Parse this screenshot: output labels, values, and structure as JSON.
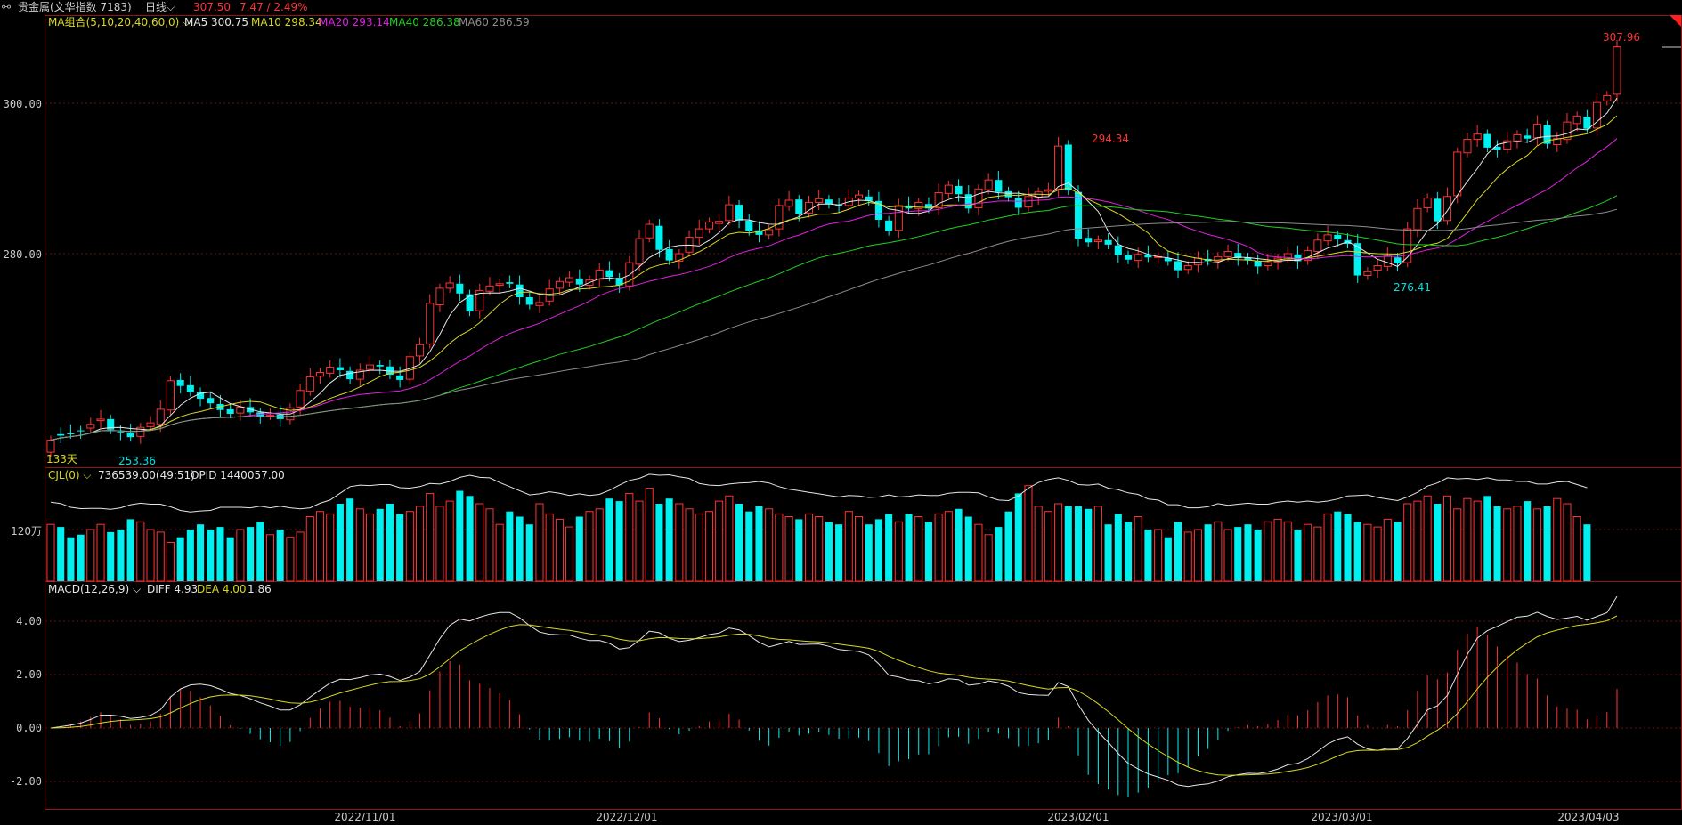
{
  "header": {
    "icon": "link-icon",
    "instrument": "贵金属(文华指数 7183)",
    "period": "日线",
    "last_price": "307.50",
    "change": "7.47 / 2.49%"
  },
  "colors": {
    "up": "#ff3333",
    "down": "#00f0f0",
    "ma5": "#e6e6e6",
    "ma10": "#d8d820",
    "ma20": "#e020e0",
    "ma40": "#20d020",
    "ma60": "#8c8c8c",
    "grid": "#6a1010",
    "diff": "#e6e6e6",
    "dea": "#d8d820"
  },
  "price_panel": {
    "indicator": "MA组合(5,10,20,40,60,0)",
    "ma_labels": [
      {
        "name": "MA5",
        "value": "300.75",
        "color": "#e6e6e6"
      },
      {
        "name": "MA10",
        "value": "298.34",
        "color": "#d8d820"
      },
      {
        "name": "MA20",
        "value": "293.14",
        "color": "#e020e0"
      },
      {
        "name": "MA40",
        "value": "286.38",
        "color": "#20d020"
      },
      {
        "name": "MA60",
        "value": "286.59",
        "color": "#8c8c8c"
      }
    ],
    "y_ticks": [
      "300.00",
      "280.00"
    ],
    "annotations": {
      "high_last": "307.96",
      "peak": "294.34",
      "low_start": "253.36",
      "low_mid": "276.41"
    },
    "days_label": "133天"
  },
  "volume_panel": {
    "indicator": "CJL(0)",
    "values_text": "736539.00(49:51)",
    "opid_text": "OPID 1440057.00",
    "y_tick": "120万"
  },
  "macd_panel": {
    "indicator": "MACD(12,26,9)",
    "diff_text": "DIFF 4.93",
    "dea_text": "DEA 4.00",
    "macd_text": "1.86",
    "y_ticks": [
      "4.00",
      "2.00",
      "0.00",
      "-2.00"
    ]
  },
  "x_axis": {
    "date_labels": [
      "2022/11/01",
      "2022/12/01",
      "2023/02/01",
      "2023/03/01",
      "2023/04/03"
    ]
  },
  "chart_data": {
    "type": "candlestick",
    "close": [
      255.2,
      255.8,
      256.0,
      256.4,
      257.3,
      258.0,
      256.6,
      256.2,
      255.6,
      256.9,
      257.5,
      259.3,
      263.1,
      262.4,
      261.6,
      260.7,
      260.1,
      259.2,
      258.7,
      259.6,
      258.9,
      258.4,
      258.5,
      258.0,
      259.5,
      261.8,
      263.6,
      264.2,
      264.9,
      264.5,
      263.3,
      264.5,
      265.2,
      265.0,
      263.9,
      263.2,
      266.3,
      267.9,
      273.4,
      275.4,
      276.1,
      274.7,
      272.3,
      275.1,
      275.7,
      276.0,
      276.0,
      274.2,
      273.2,
      273.5,
      275.3,
      276.3,
      276.8,
      275.9,
      276.5,
      277.8,
      276.9,
      275.8,
      278.8,
      282.0,
      283.9,
      280.5,
      279.1,
      280.0,
      282.2,
      283.3,
      284.2,
      284.3,
      286.5,
      284.4,
      283.0,
      282.5,
      283.2,
      286.4,
      287.1,
      285.3,
      286.8,
      287.3,
      286.6,
      286.4,
      287.4,
      287.8,
      287.0,
      284.5,
      283.0,
      286.4,
      286.0,
      286.8,
      286.0,
      288.1,
      289.1,
      287.9,
      286.0,
      288.6,
      289.8,
      288.2,
      287.5,
      286.1,
      287.6,
      288.2,
      288.5,
      294.3,
      288.4,
      282.0,
      281.5,
      281.8,
      281.2,
      279.8,
      279.2,
      279.9,
      279.5,
      279.6,
      279.0,
      277.8,
      278.4,
      279.4,
      279.0,
      279.6,
      280.3,
      279.4,
      279.1,
      278.3,
      278.8,
      279.4,
      280.0,
      279.0,
      280.4,
      281.8,
      282.5,
      281.9,
      281.3,
      277.1,
      277.6,
      278.4,
      279.7,
      278.7,
      283.3,
      286.0,
      287.4,
      284.3,
      287.6,
      293.5,
      295.2,
      295.9,
      294.1,
      293.8,
      295.0,
      295.8,
      295.3,
      297.2,
      294.6,
      295.3,
      297.5,
      298.3,
      296.6,
      300.1,
      301.0,
      307.5
    ],
    "open": [
      253.6,
      256.0,
      256.1,
      256.5,
      256.8,
      257.8,
      258.0,
      256.3,
      256.2,
      255.7,
      257.0,
      257.3,
      259.2,
      263.2,
      262.5,
      261.6,
      260.8,
      260.0,
      259.3,
      258.8,
      259.6,
      258.9,
      258.5,
      258.6,
      257.9,
      259.6,
      261.7,
      263.7,
      264.1,
      264.9,
      264.4,
      263.3,
      264.6,
      265.2,
      265.0,
      263.8,
      263.3,
      266.4,
      268.0,
      273.2,
      275.4,
      276.0,
      274.6,
      272.4,
      275.0,
      275.8,
      276.2,
      275.9,
      274.2,
      273.1,
      273.7,
      275.4,
      276.2,
      276.7,
      275.8,
      276.6,
      277.8,
      276.8,
      275.7,
      278.6,
      282.1,
      283.7,
      280.6,
      279.0,
      280.2,
      282.2,
      283.3,
      284.0,
      284.4,
      286.5,
      284.4,
      283.1,
      282.5,
      283.3,
      286.3,
      287.2,
      285.4,
      286.8,
      287.2,
      286.5,
      286.4,
      287.4,
      287.6,
      287.0,
      284.4,
      283.1,
      286.4,
      286.0,
      286.6,
      286.1,
      288.0,
      289.0,
      287.9,
      286.1,
      288.5,
      289.8,
      288.3,
      287.4,
      286.2,
      287.5,
      288.3,
      288.6,
      294.5,
      288.2,
      282.1,
      281.6,
      281.8,
      281.1,
      279.8,
      279.1,
      279.9,
      279.6,
      279.4,
      279.0,
      277.9,
      278.5,
      279.3,
      279.0,
      279.6,
      280.1,
      279.5,
      279.0,
      278.4,
      278.9,
      279.3,
      279.9,
      279.1,
      280.3,
      281.7,
      282.5,
      281.8,
      281.4,
      277.1,
      277.8,
      278.3,
      279.5,
      278.8,
      283.2,
      286.1,
      287.3,
      284.4,
      287.7,
      293.4,
      295.2,
      295.9,
      294.2,
      293.9,
      295.0,
      295.7,
      295.4,
      297.1,
      294.5,
      295.2,
      297.3,
      298.2,
      296.7,
      300.3,
      301.2
    ],
    "volume_millions": [
      1.22,
      1.21,
      1.17,
      1.18,
      1.2,
      1.22,
      1.19,
      1.2,
      1.24,
      1.23,
      1.2,
      1.19,
      1.15,
      1.17,
      1.2,
      1.22,
      1.2,
      1.21,
      1.17,
      1.2,
      1.21,
      1.23,
      1.18,
      1.2,
      1.17,
      1.19,
      1.25,
      1.27,
      1.26,
      1.3,
      1.32,
      1.28,
      1.26,
      1.28,
      1.3,
      1.26,
      1.27,
      1.29,
      1.34,
      1.29,
      1.31,
      1.35,
      1.33,
      1.3,
      1.28,
      1.22,
      1.27,
      1.25,
      1.22,
      1.3,
      1.26,
      1.24,
      1.21,
      1.25,
      1.27,
      1.28,
      1.32,
      1.31,
      1.34,
      1.31,
      1.36,
      1.3,
      1.32,
      1.3,
      1.28,
      1.26,
      1.27,
      1.31,
      1.33,
      1.3,
      1.27,
      1.29,
      1.28,
      1.26,
      1.25,
      1.24,
      1.26,
      1.25,
      1.23,
      1.22,
      1.27,
      1.25,
      1.22,
      1.24,
      1.26,
      1.23,
      1.26,
      1.25,
      1.23,
      1.26,
      1.27,
      1.28,
      1.25,
      1.22,
      1.18,
      1.21,
      1.27,
      1.34,
      1.37,
      1.29,
      1.27,
      1.3,
      1.29,
      1.29,
      1.28,
      1.29,
      1.22,
      1.26,
      1.23,
      1.25,
      1.2,
      1.2,
      1.17,
      1.23,
      1.19,
      1.2,
      1.22,
      1.23,
      1.2,
      1.21,
      1.22,
      1.2,
      1.23,
      1.24,
      1.23,
      1.2,
      1.22,
      1.21,
      1.26,
      1.27,
      1.26,
      1.23,
      1.22,
      1.21,
      1.24,
      1.23,
      1.3,
      1.31,
      1.33,
      1.3,
      1.33,
      1.28,
      1.32,
      1.31,
      1.33,
      1.29,
      1.28,
      1.29,
      1.31,
      1.28,
      1.29,
      1.32,
      1.3,
      1.25,
      1.22
    ],
    "ma": {
      "MA5": {
        "last": 300.75
      },
      "MA10": {
        "last": 298.34
      },
      "MA20": {
        "last": 293.14
      },
      "MA40": {
        "last": 286.38
      },
      "MA60": {
        "last": 286.59
      }
    },
    "macd": {
      "diff_last": 4.93,
      "dea_last": 4.0,
      "macd_last": 1.86
    },
    "ylim_price": [
      252,
      310
    ],
    "ylim_macd": [
      -2.8,
      5.6
    ]
  }
}
